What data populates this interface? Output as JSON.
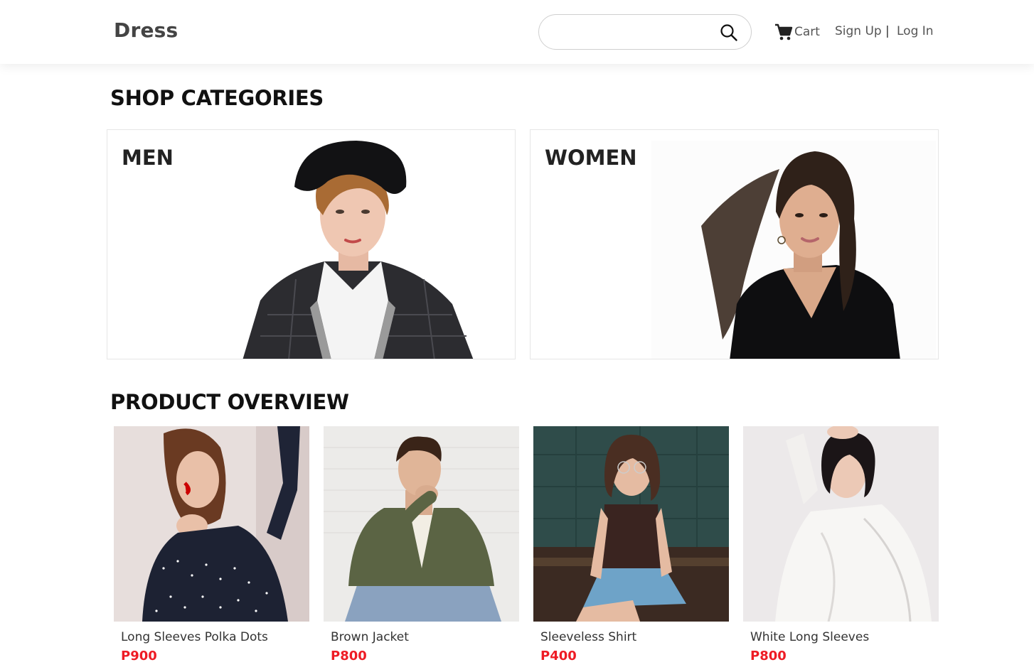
{
  "header": {
    "brand": "Dress",
    "search": {
      "placeholder": "",
      "value": ""
    },
    "cart_label": "Cart",
    "signup_label": "Sign Up",
    "separator": "|",
    "login_label": "Log In"
  },
  "categories": {
    "title": "SHOP CATEGORIES",
    "items": [
      {
        "label": "MEN"
      },
      {
        "label": "WOMEN"
      }
    ]
  },
  "products": {
    "title": "PRODUCT OVERVIEW",
    "accent_price_color": "#ee1c25",
    "items": [
      {
        "name": "Long Sleeves Polka Dots",
        "price": "P900"
      },
      {
        "name": "Brown Jacket",
        "price": "P800"
      },
      {
        "name": "Sleeveless Shirt",
        "price": "P400"
      },
      {
        "name": "White Long Sleeves",
        "price": "P800"
      }
    ]
  },
  "icons": {
    "search": "search-icon",
    "cart": "cart-icon"
  }
}
